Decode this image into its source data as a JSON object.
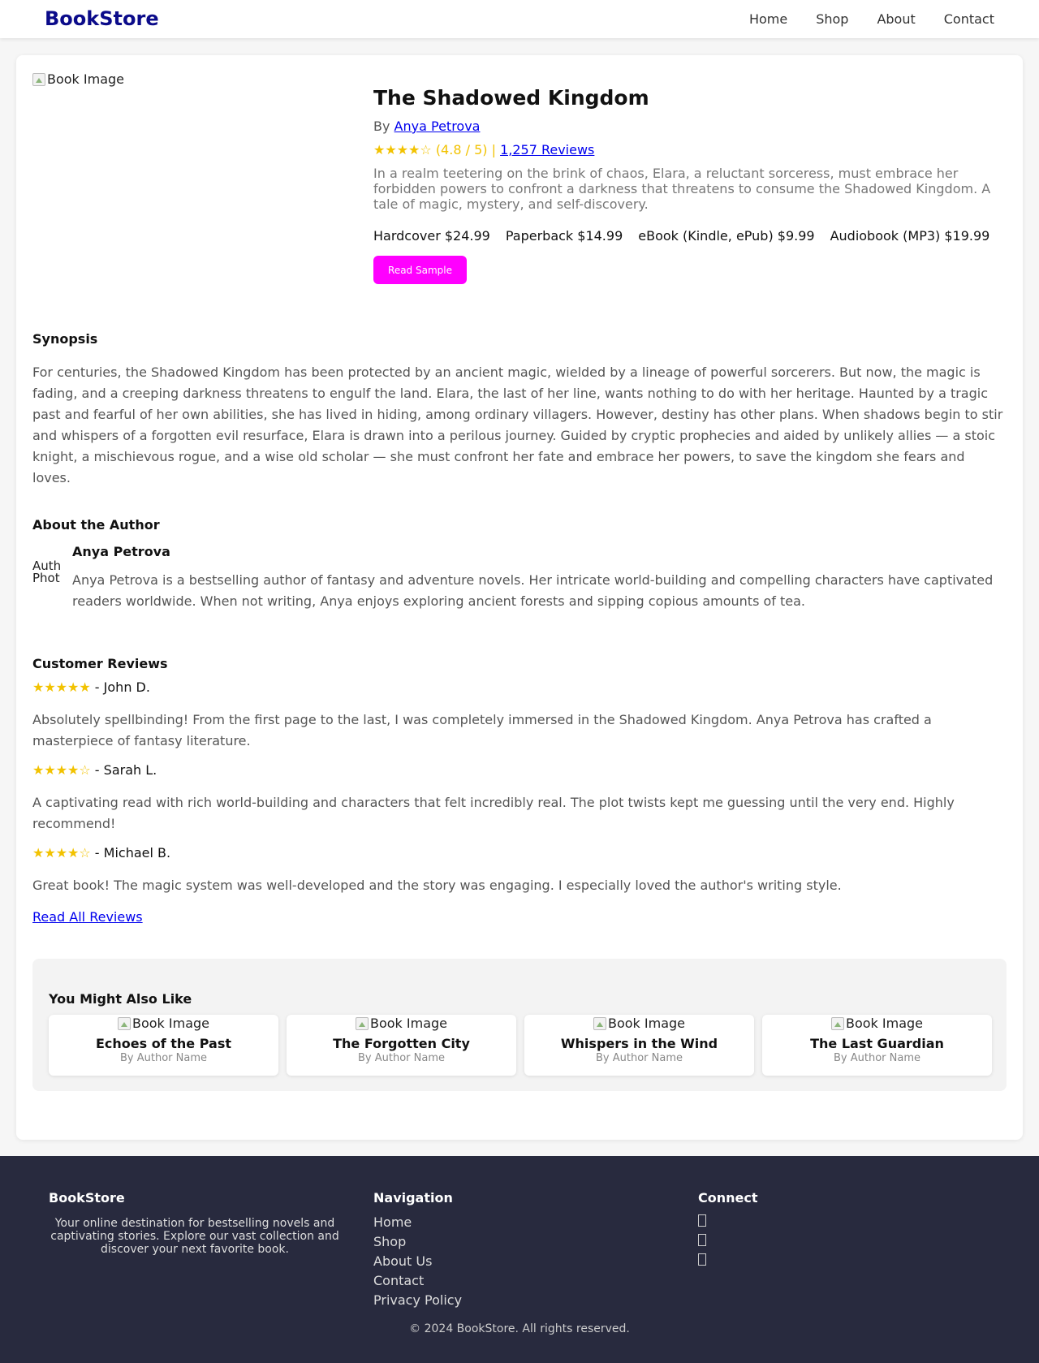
{
  "header": {
    "logo": "BookStore",
    "nav": [
      "Home",
      "Shop",
      "About",
      "Contact"
    ]
  },
  "book": {
    "image_alt": "Book Image",
    "title": "The Shadowed Kingdom",
    "by_prefix": "By",
    "author": "Anya Petrova",
    "rating_stars": "★★★★☆",
    "rating_text": "(4.8 / 5) |",
    "reviews_link": "1,257 Reviews",
    "description": "In a realm teetering on the brink of chaos, Elara, a reluctant sorceress, must embrace her forbidden powers to confront a darkness that threatens to consume the Shadowed Kingdom. A tale of magic, mystery, and self-discovery.",
    "formats": [
      "Hardcover $24.99",
      "Paperback $14.99",
      "eBook (Kindle, ePub) $9.99",
      "Audiobook (MP3) $19.99"
    ],
    "read_sample": "Read Sample"
  },
  "synopsis": {
    "heading": "Synopsis",
    "text": "For centuries, the Shadowed Kingdom has been protected by an ancient magic, wielded by a lineage of powerful sorcerers. But now, the magic is fading, and a creeping darkness threatens to engulf the land. Elara, the last of her line, wants nothing to do with her heritage. Haunted by a tragic past and fearful of her own abilities, she has lived in hiding, among ordinary villagers. However, destiny has other plans. When shadows begin to stir and whispers of a forgotten evil resurface, Elara is drawn into a perilous journey. Guided by cryptic prophecies and aided by unlikely allies — a stoic knight, a mischievous rogue, and a wise old scholar — she must confront her fate and embrace her powers, to save the kingdom she fears and loves."
  },
  "author_section": {
    "heading": "About the Author",
    "photo_alt": "Author Photo",
    "name": "Anya Petrova",
    "bio": "Anya Petrova is a bestselling author of fantasy and adventure novels. Her intricate world-building and compelling characters have captivated readers worldwide. When not writing, Anya enjoys exploring ancient forests and sipping copious amounts of tea."
  },
  "reviews": {
    "heading": "Customer Reviews",
    "items": [
      {
        "stars": "★★★★★",
        "reviewer": " - John D.",
        "text": "Absolutely spellbinding! From the first page to the last, I was completely immersed in the Shadowed Kingdom. Anya Petrova has crafted a masterpiece of fantasy literature."
      },
      {
        "stars": "★★★★☆",
        "reviewer": " - Sarah L.",
        "text": "A captivating read with rich world-building and characters that felt incredibly real. The plot twists kept me guessing until the very end. Highly recommend!"
      },
      {
        "stars": "★★★★☆",
        "reviewer": " - Michael B.",
        "text": "Great book! The magic system was well-developed and the story was engaging. I especially loved the author's writing style."
      }
    ],
    "read_all": "Read All Reviews"
  },
  "also_like": {
    "heading": "You Might Also Like",
    "books": [
      {
        "image_alt": "Book Image",
        "title": "Echoes of the Past",
        "author": "By Author Name"
      },
      {
        "image_alt": "Book Image",
        "title": "The Forgotten City",
        "author": "By Author Name"
      },
      {
        "image_alt": "Book Image",
        "title": "Whispers in the Wind",
        "author": "By Author Name"
      },
      {
        "image_alt": "Book Image",
        "title": "The Last Guardian",
        "author": "By Author Name"
      }
    ]
  },
  "footer": {
    "about_heading": "BookStore",
    "about_text": "Your online destination for bestselling novels and captivating stories. Explore our vast collection and discover your next favorite book.",
    "nav_heading": "Navigation",
    "nav_links": [
      "Home",
      "Shop",
      "About Us",
      "Contact",
      "Privacy Policy"
    ],
    "connect_heading": "Connect",
    "social_icons": [
      "social-icon-1",
      "social-icon-2",
      "social-icon-3"
    ],
    "copyright": "© 2024 BookStore. All rights reserved."
  },
  "colors": {
    "logo": "#0b0b8a",
    "accent_button": "#ff00ff",
    "star": "#f2c200",
    "link": "#0000ee",
    "footer_bg": "#282a3e"
  }
}
